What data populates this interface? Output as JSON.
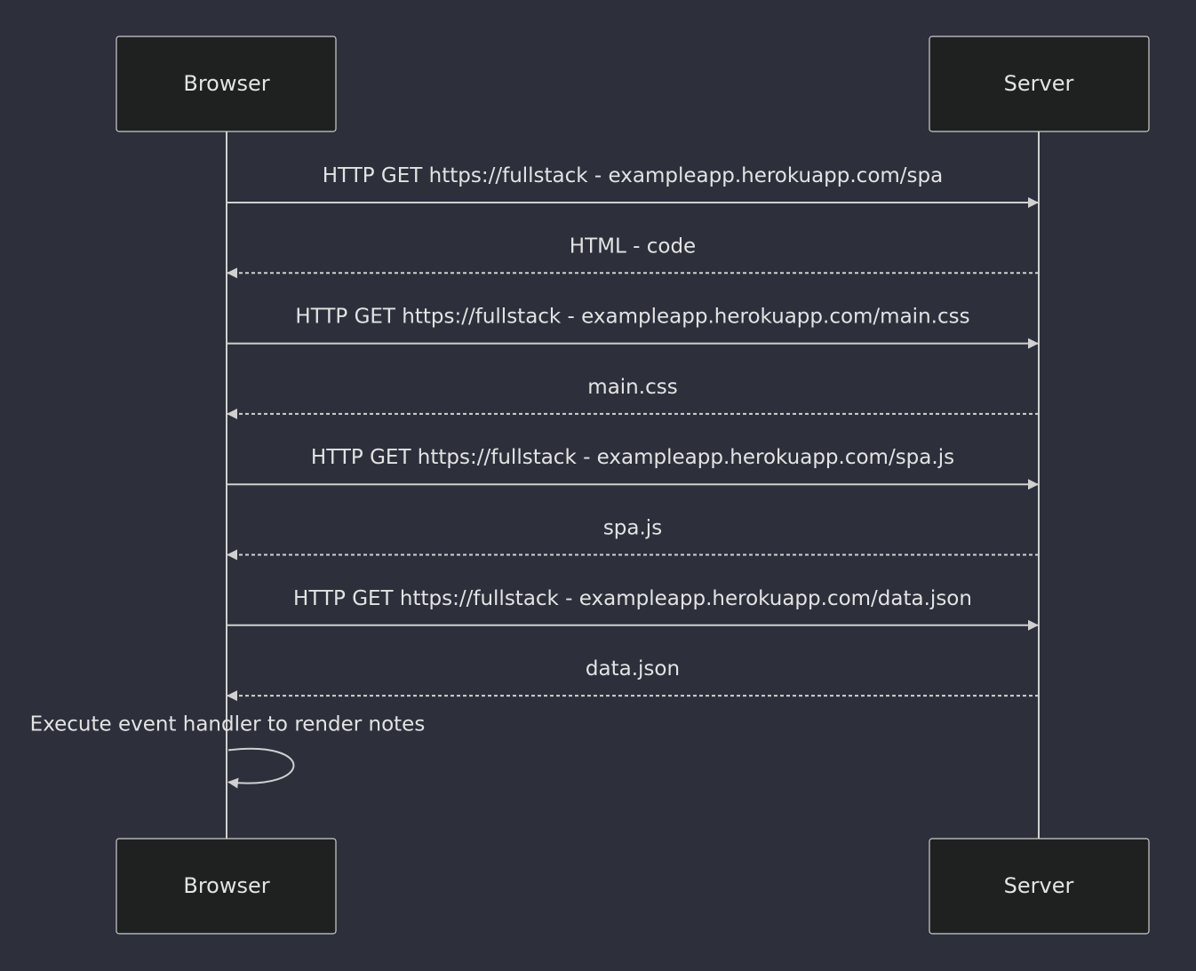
{
  "diagram": {
    "type": "sequence",
    "colors": {
      "background": "#2d303b",
      "actor_fill": "#1f2020",
      "actor_border": "#cccccc",
      "line": "#d0d0d0",
      "text": "#e3e3e3"
    },
    "participants": [
      {
        "id": "browser",
        "label": "Browser"
      },
      {
        "id": "server",
        "label": "Server"
      }
    ],
    "messages": [
      {
        "from": "browser",
        "to": "server",
        "label": "HTTP GET https://fullstack - exampleapp.herokuapp.com/spa",
        "style": "solid"
      },
      {
        "from": "server",
        "to": "browser",
        "label": "HTML - code",
        "style": "dashed"
      },
      {
        "from": "browser",
        "to": "server",
        "label": "HTTP GET https://fullstack - exampleapp.herokuapp.com/main.css",
        "style": "solid"
      },
      {
        "from": "server",
        "to": "browser",
        "label": "main.css",
        "style": "dashed"
      },
      {
        "from": "browser",
        "to": "server",
        "label": "HTTP GET https://fullstack - exampleapp.herokuapp.com/spa.js",
        "style": "solid"
      },
      {
        "from": "server",
        "to": "browser",
        "label": "spa.js",
        "style": "dashed"
      },
      {
        "from": "browser",
        "to": "server",
        "label": "HTTP GET https://fullstack - exampleapp.herokuapp.com/data.json",
        "style": "solid"
      },
      {
        "from": "server",
        "to": "browser",
        "label": "data.json",
        "style": "dashed"
      },
      {
        "from": "browser",
        "to": "browser",
        "label": "Execute event handler to render notes",
        "style": "self"
      }
    ]
  }
}
